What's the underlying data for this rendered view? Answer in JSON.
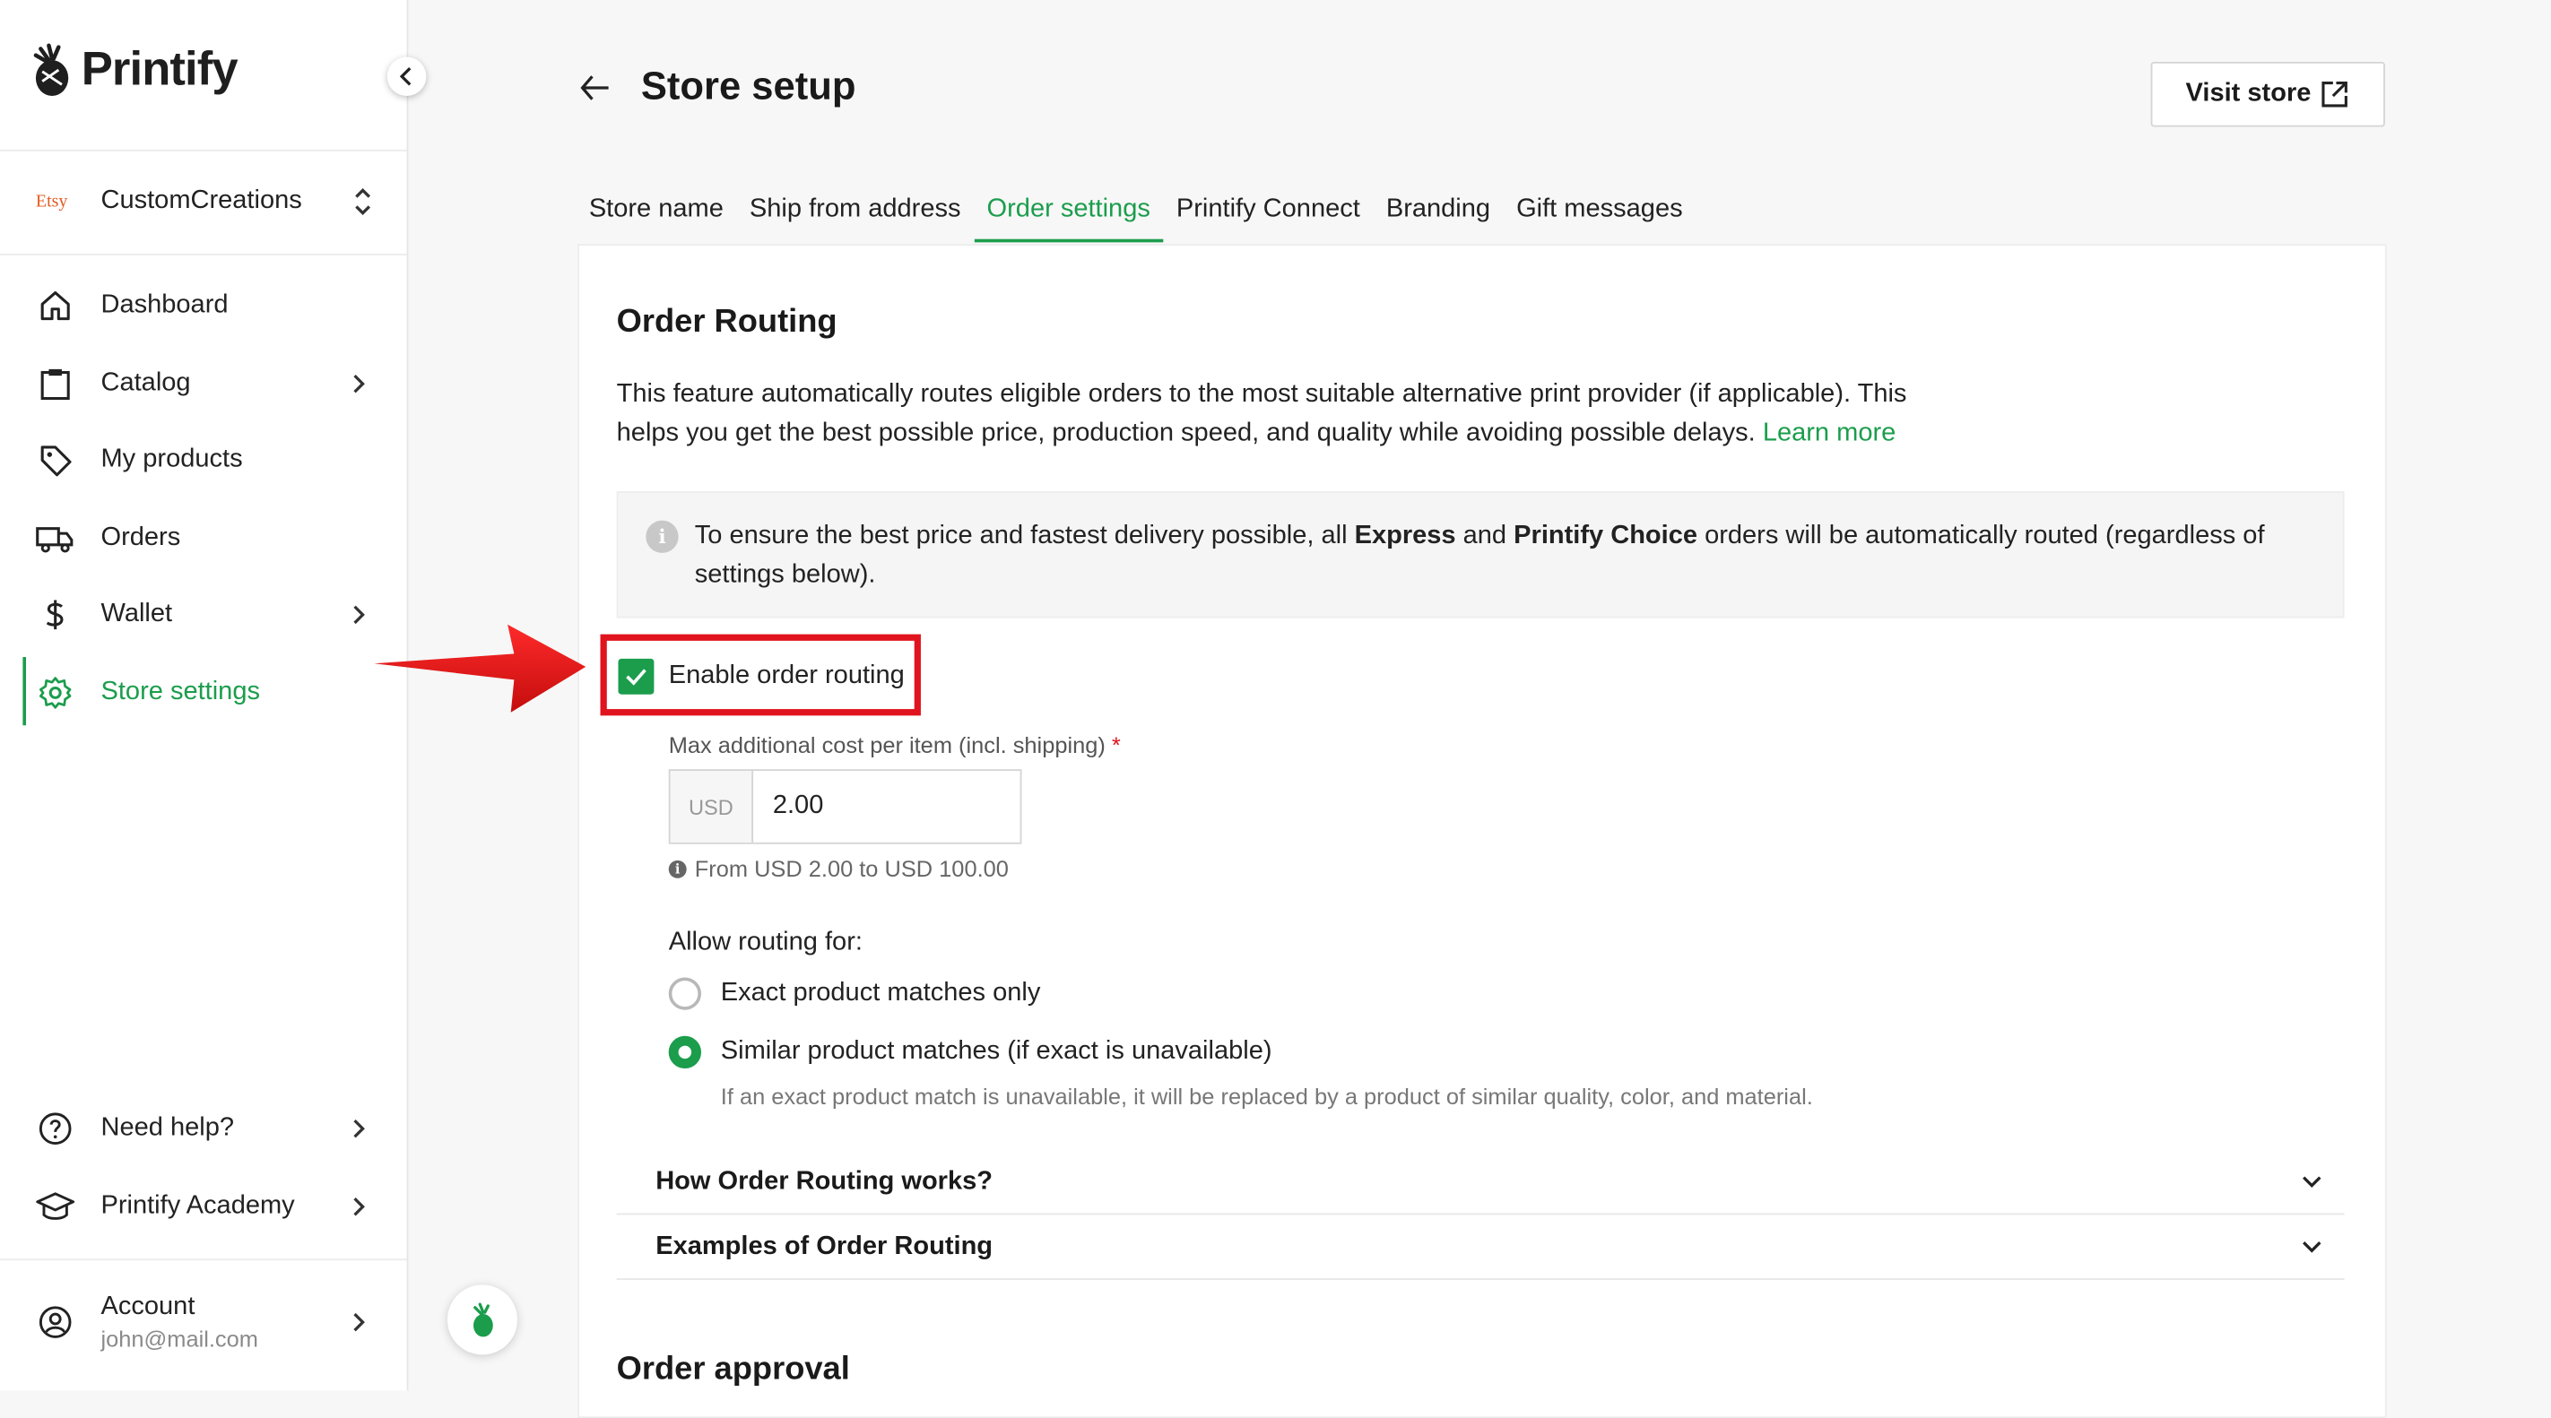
{
  "brand": {
    "name": "Printify"
  },
  "sidebar": {
    "store": {
      "platform": "Etsy",
      "name": "CustomCreations"
    },
    "items": [
      {
        "label": "Dashboard",
        "icon": "home-icon"
      },
      {
        "label": "Catalog",
        "icon": "clipboard-icon"
      },
      {
        "label": "My products",
        "icon": "tag-icon"
      },
      {
        "label": "Orders",
        "icon": "truck-icon"
      },
      {
        "label": "Wallet",
        "icon": "dollar-icon"
      },
      {
        "label": "Store settings",
        "icon": "gear-icon"
      }
    ],
    "bottom": [
      {
        "label": "Need help?",
        "icon": "help-circle-icon"
      },
      {
        "label": "Printify Academy",
        "icon": "graduation-cap-icon"
      }
    ],
    "account": {
      "label": "Account",
      "email": "john@mail.com"
    }
  },
  "header": {
    "title": "Store setup",
    "visit_store": "Visit store"
  },
  "tabs": [
    "Store name",
    "Ship from address",
    "Order settings",
    "Printify Connect",
    "Branding",
    "Gift messages"
  ],
  "active_tab": "Order settings",
  "routing": {
    "title": "Order Routing",
    "desc_line1": "This feature automatically routes eligible orders to the most suitable alternative print provider (if applicable). This",
    "desc_line2": "helps you get the best possible price, production speed, and quality while avoiding possible delays.",
    "learn_more": "Learn more",
    "info": {
      "pre": "To ensure the best price and fastest delivery possible, all ",
      "b1": "Express",
      "mid": " and ",
      "b2": "Printify Choice",
      "post": " orders will be automatically routed (regardless of settings below)."
    },
    "enable_label": "Enable order routing",
    "max_cost_label": "Max additional cost per item (incl. shipping)",
    "currency": "USD",
    "max_cost_value": "2.00",
    "range_hint": "From USD 2.00 to USD 100.00",
    "allow_label": "Allow routing for:",
    "option_exact": "Exact product matches only",
    "option_similar": "Similar product matches (if exact is unavailable)",
    "similar_hint": "If an exact product match is unavailable, it will be replaced by a product of similar quality, color, and material.",
    "accordion1": "How Order Routing works?",
    "accordion2": "Examples of Order Routing"
  },
  "approval": {
    "title": "Order approval"
  },
  "colors": {
    "accent": "#1b9d4c",
    "annotation": "#e0141e"
  }
}
